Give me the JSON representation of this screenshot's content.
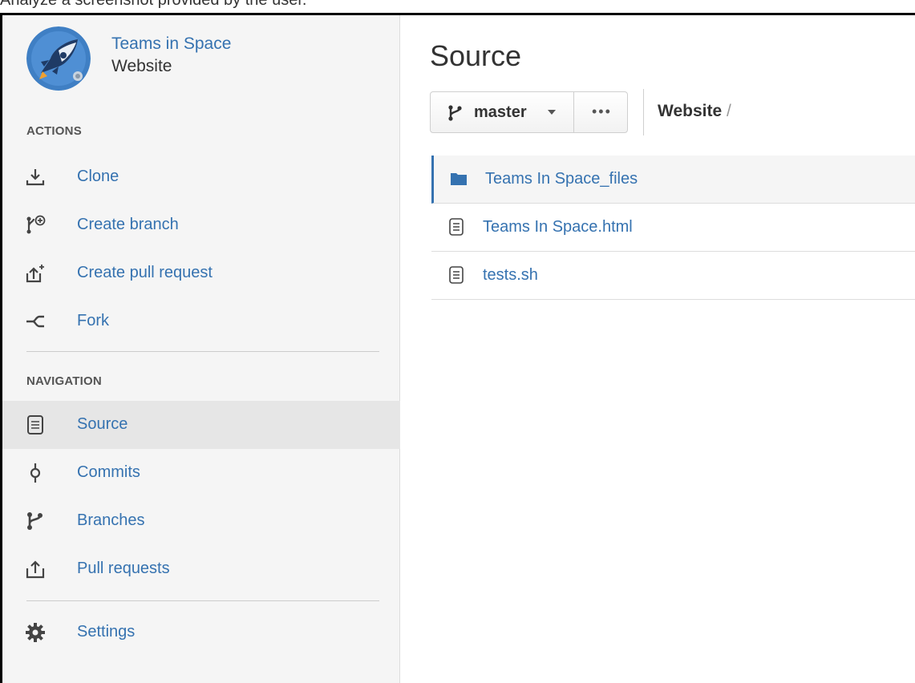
{
  "window_caption": "Analyze a screenshot provided by the user.",
  "project": {
    "name": "Teams in Space",
    "repository": "Website"
  },
  "sidebar": {
    "actions_heading": "ACTIONS",
    "actions": [
      {
        "label": "Clone",
        "icon": "clone-icon"
      },
      {
        "label": "Create branch",
        "icon": "create-branch-icon"
      },
      {
        "label": "Create pull request",
        "icon": "create-pull-request-icon"
      },
      {
        "label": "Fork",
        "icon": "fork-icon"
      }
    ],
    "navigation_heading": "NAVIGATION",
    "navigation": [
      {
        "label": "Source",
        "icon": "source-icon",
        "active": true
      },
      {
        "label": "Commits",
        "icon": "commits-icon"
      },
      {
        "label": "Branches",
        "icon": "branches-icon"
      },
      {
        "label": "Pull requests",
        "icon": "pull-requests-icon"
      }
    ],
    "settings": {
      "label": "Settings",
      "icon": "gear-icon"
    }
  },
  "main": {
    "title": "Source",
    "branch": "master",
    "more_label": "•••",
    "breadcrumb": {
      "repo": "Website",
      "separator": " /"
    },
    "files": [
      {
        "name": "Teams In Space_files",
        "type": "folder",
        "icon": "folder-icon",
        "selected": true
      },
      {
        "name": "Teams In Space.html",
        "type": "file",
        "icon": "file-icon"
      },
      {
        "name": "tests.sh",
        "type": "file",
        "icon": "file-icon"
      }
    ]
  },
  "colors": {
    "link": "#3572b0",
    "sidebar_bg": "#f5f5f5",
    "active_bg": "#e6e6e6",
    "text": "#333333"
  }
}
